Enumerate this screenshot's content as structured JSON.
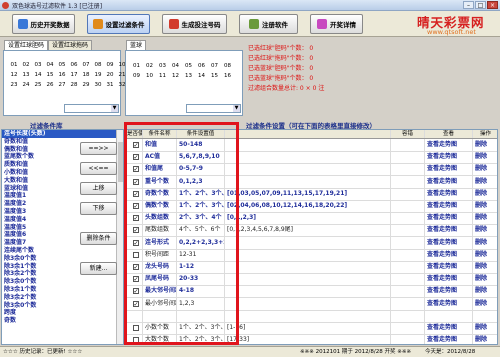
{
  "window": {
    "title": "双色球选号过滤软件 1.3  [已注册]",
    "min": "–",
    "max": "□",
    "close": "×"
  },
  "toolbar": {
    "btn1": "历史开奖数据",
    "btn2": "设置过滤条件",
    "btn3": "生成投注号码",
    "btn4": "注册软件",
    "btn5": "开奖详情"
  },
  "logo": {
    "main": "晴天彩票网",
    "sub": "www.qtsoft.net"
  },
  "red_tabs": [
    "设置红球胆码",
    "设置红球拖码"
  ],
  "blue_tab": "蓝球",
  "red_numbers": [
    "01",
    "02",
    "03",
    "04",
    "05",
    "06",
    "07",
    "08",
    "09",
    "10",
    "11",
    "12",
    "13",
    "14",
    "15",
    "16",
    "17",
    "18",
    "19",
    "20",
    "21",
    "22",
    "23",
    "24",
    "25",
    "26",
    "27",
    "28",
    "29",
    "30",
    "31",
    "32",
    "33"
  ],
  "blue_numbers": [
    "01",
    "02",
    "03",
    "04",
    "05",
    "06",
    "07",
    "08",
    "09",
    "10",
    "11",
    "12",
    "13",
    "14",
    "15",
    "16"
  ],
  "stats": [
    "已选红球\"胆码\"个数：  0",
    "已选红球\"拖码\"个数：  0",
    "已选蓝球\"胆码\"个数：  0",
    "已选蓝球\"拖码\"个数：  0",
    "过滤组合数量总计: 0 × 0  注"
  ],
  "left_title": "过滤条件库",
  "right_title": "过滤条件设置（可在下面的表格里直接修改）",
  "left_items": [
    "连号长度(头数)",
    "奇数和值",
    "偶数和值",
    "蓝尾数个数",
    "质数和值",
    "小数和值",
    "大数和值",
    "蓝球和值",
    "温度值1",
    "温度值2",
    "温度值3",
    "温度值4",
    "温度值5",
    "温度值6",
    "温度值7",
    "连续尾个数",
    "除3余0个数",
    "除3余1个数",
    "除3余2个数",
    "除3余0个数",
    "除3余1个数",
    "除3余2个数",
    "除3余0个数",
    "跨度",
    "奇数"
  ],
  "mid_buttons": {
    "add": "==>>",
    "remove": "<<==",
    "up": "上移",
    "down": "下移",
    "delete": "删除条件",
    "new": "新建..."
  },
  "grid_headers": [
    "是否使用",
    "条件名称",
    "条件设置值",
    "",
    "容错",
    "查看",
    "操作"
  ],
  "grid_rows": [
    {
      "use": true,
      "name": "和值",
      "value": "50-148",
      "extra": "",
      "view": "查看走势图",
      "op": "删除",
      "bold": true
    },
    {
      "use": true,
      "name": "AC值",
      "value": "5,6,7,8,9,10",
      "extra": "",
      "view": "查看走势图",
      "op": "删除",
      "bold": true
    },
    {
      "use": true,
      "name": "和值尾",
      "value": "0-5,7-9",
      "extra": "",
      "view": "查看走势图",
      "op": "删除",
      "bold": true
    },
    {
      "use": true,
      "name": "重号个数",
      "value": "0,1,2,3",
      "extra": "",
      "view": "查看走势图",
      "op": "删除",
      "bold": true
    },
    {
      "use": true,
      "name": "奇数个数",
      "value": "1个、2个、3个、4个、5个",
      "extra": "[01,03,05,07,09,11,13,15,17,19,21]",
      "view": "查看走势图",
      "op": "删除",
      "bold": true
    },
    {
      "use": true,
      "name": "偶数个数",
      "value": "1个、2个、3个、4个、5个",
      "extra": "[02,04,06,08,10,12,14,16,18,20,22]",
      "view": "查看走势图",
      "op": "删除",
      "bold": true
    },
    {
      "use": true,
      "name": "头数组数",
      "value": "2个、3个、4个",
      "extra": "[0,1,2,3]",
      "view": "查看走势图",
      "op": "删除",
      "bold": true
    },
    {
      "use": true,
      "name": "尾数组数",
      "value": "4个、5个、6个",
      "extra": "[0,1,2,3,4,5,6,7,8,9尾]",
      "view": "查看走势图",
      "op": "删除",
      "bold": false
    },
    {
      "use": true,
      "name": "连号形式",
      "value": "0,2,2+2,3,3+2",
      "extra": "",
      "view": "查看走势图",
      "op": "删除",
      "bold": true
    },
    {
      "use": false,
      "name": "积号间距",
      "value": "12-31",
      "extra": "",
      "view": "查看走势图",
      "op": "删除",
      "bold": false
    },
    {
      "use": true,
      "name": "龙头号码",
      "value": "1-12",
      "extra": "",
      "view": "查看走势图",
      "op": "删除",
      "bold": true
    },
    {
      "use": true,
      "name": "凤尾号码",
      "value": "20-33",
      "extra": "",
      "view": "查看走势图",
      "op": "删除",
      "bold": true
    },
    {
      "use": true,
      "name": "最大邻号间距",
      "value": "4-18",
      "extra": "",
      "view": "查看走势图",
      "op": "删除",
      "bold": true
    },
    {
      "use": true,
      "name": "最小邻号间距",
      "value": "1,2,3",
      "extra": "",
      "view": "查看走势图",
      "op": "删除",
      "bold": false
    },
    {
      "use": false,
      "name": "",
      "value": "",
      "extra": "",
      "view": "",
      "op": "",
      "bold": false
    },
    {
      "use": false,
      "name": "小数个数",
      "value": "1个、2个、3个、4个、5个",
      "extra": "[1-16]",
      "view": "查看走势图",
      "op": "删除",
      "bold": false
    },
    {
      "use": false,
      "name": "大数个数",
      "value": "1个、2个、3个、4个、5个",
      "extra": "[17-33]",
      "view": "查看走势图",
      "op": "删除",
      "bold": false
    }
  ],
  "status": {
    "left": "☆☆☆  历史记录：已更新!  ☆☆☆",
    "right": "※※※  2012101 期于 2012/8/28 开奖 ※※※",
    "today": "今天是：2012/8/28"
  },
  "colors": {
    "accent_red": "#e0141c",
    "title_blue": "#1a2e8a",
    "selection": "#2a59c4"
  }
}
